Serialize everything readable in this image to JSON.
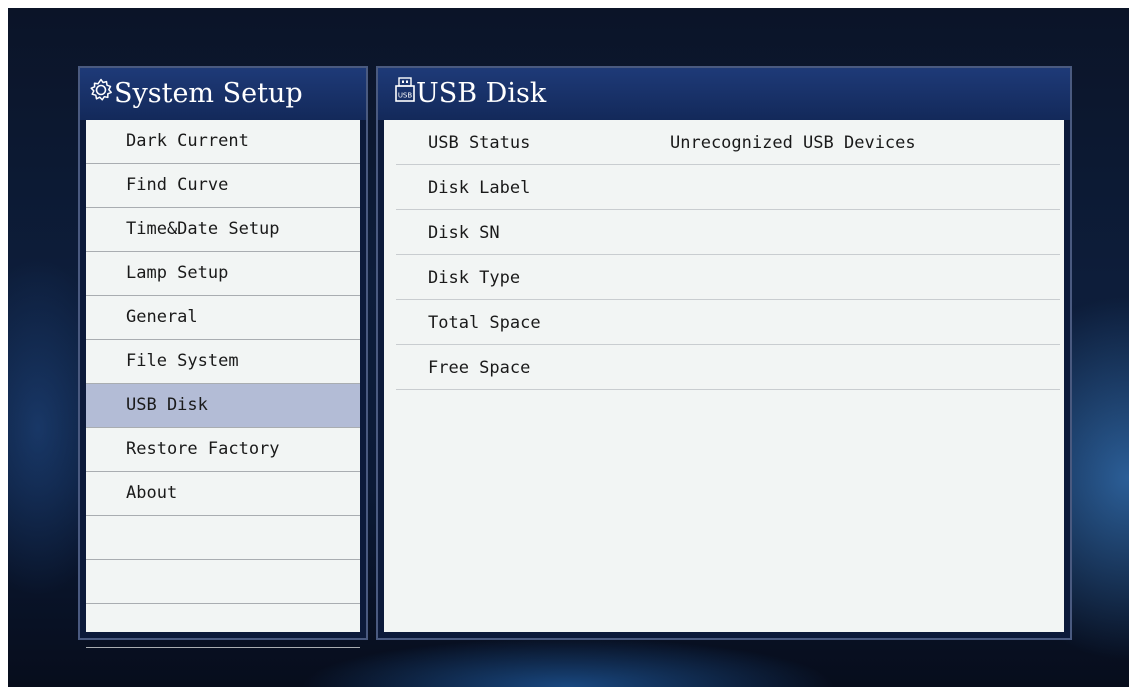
{
  "sidebar": {
    "title": "System Setup",
    "icon": "gear-icon",
    "items": [
      {
        "label": "Dark Current"
      },
      {
        "label": "Find Curve"
      },
      {
        "label": "Time&Date Setup"
      },
      {
        "label": "Lamp Setup"
      },
      {
        "label": "General"
      },
      {
        "label": "File System"
      },
      {
        "label": "USB Disk",
        "selected": true
      },
      {
        "label": "Restore Factory"
      },
      {
        "label": "About"
      },
      {
        "label": ""
      },
      {
        "label": ""
      },
      {
        "label": ""
      }
    ]
  },
  "main": {
    "title": "USB Disk",
    "icon": "usb-disk-icon",
    "rows": [
      {
        "label": "USB Status",
        "value": "Unrecognized USB Devices"
      },
      {
        "label": "Disk Label",
        "value": ""
      },
      {
        "label": "Disk SN",
        "value": ""
      },
      {
        "label": "Disk Type",
        "value": ""
      },
      {
        "label": "Total Space",
        "value": ""
      },
      {
        "label": "Free Space",
        "value": ""
      }
    ]
  },
  "colors": {
    "header": "#1b3570",
    "selected_item": "#b3bcd6",
    "panel_body": "#f2f5f4"
  }
}
